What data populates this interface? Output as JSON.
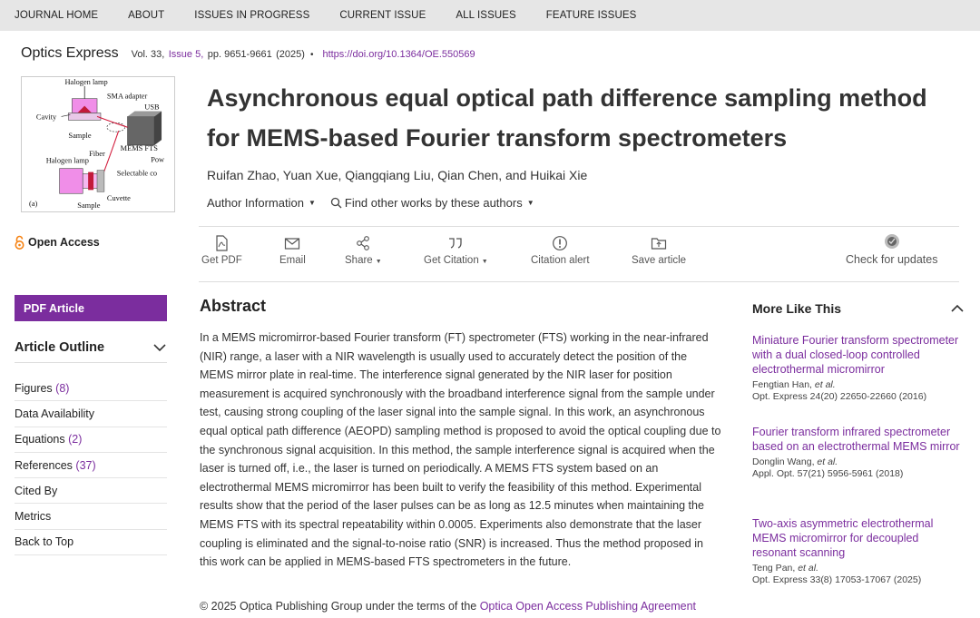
{
  "nav": [
    "JOURNAL HOME",
    "ABOUT",
    "ISSUES IN PROGRESS",
    "CURRENT ISSUE",
    "ALL ISSUES",
    "FEATURE ISSUES"
  ],
  "journal": {
    "name": "Optics Express",
    "vol": "Vol. 33,",
    "issue": "Issue 5,",
    "pages": "pp. 9651-9661",
    "year": "(2025)",
    "doi": "https://doi.org/10.1364/OE.550569"
  },
  "figure": {
    "labels": [
      "Halogen lamp",
      "SMA adapter",
      "USB",
      "Cavity",
      "Sample",
      "MEMS FTS",
      "Fiber",
      "Halogen lamp",
      "Pow",
      "Selectable co",
      "Cuvette",
      "Sample",
      "(a)"
    ]
  },
  "open_access": "Open Access",
  "sidebar": {
    "pdf_label": "PDF Article",
    "outline_title": "Article Outline",
    "items": [
      {
        "label": "Figures",
        "count": "(8)"
      },
      {
        "label": "Data Availability",
        "count": ""
      },
      {
        "label": "Equations",
        "count": "(2)"
      },
      {
        "label": "References",
        "count": "(37)"
      },
      {
        "label": "Cited By",
        "count": ""
      },
      {
        "label": "Metrics",
        "count": ""
      },
      {
        "label": "Back to Top",
        "count": ""
      }
    ]
  },
  "article": {
    "title": "Asynchronous equal optical path difference sampling method for MEMS-based Fourier transform spectrometers",
    "authors": "Ruifan Zhao, Yuan Xue, Qiangqiang Liu, Qian Chen, and Huikai Xie",
    "author_info": "Author Information",
    "find_works": "Find other works by these authors"
  },
  "toolbar": {
    "get_pdf": "Get PDF",
    "email": "Email",
    "share": "Share",
    "get_citation": "Get Citation",
    "citation_alert": "Citation alert",
    "save_article": "Save article",
    "check_updates": "Check for updates"
  },
  "abstract": {
    "heading": "Abstract",
    "body": "In a MEMS micromirror-based Fourier transform (FT) spectrometer (FTS) working in the near-infrared (NIR) range, a laser with a NIR wavelength is usually used to accurately detect the position of the MEMS mirror plate in real-time. The interference signal generated by the NIR laser for position measurement is acquired synchronously with the broadband interference signal from the sample under test, causing strong coupling of the laser signal into the sample signal. In this work, an asynchronous equal optical path difference (AEOPD) sampling method is proposed to avoid the optical coupling due to the synchronous signal acquisition. In this method, the sample interference signal is acquired when the laser is turned off, i.e., the laser is turned on periodically. A MEMS FTS system based on an electrothermal MEMS micromirror has been built to verify the feasibility of this method. Experimental results show that the period of the laser pulses can be as long as 12.5 minutes when maintaining the MEMS FTS with its spectral repeatability within 0.0005. Experiments also demonstrate that the laser coupling is eliminated and the signal-to-noise ratio (SNR) is increased. Thus the method proposed in this work can be applied in MEMS-based FTS spectrometers in the future.",
    "copyright_prefix": "© 2025 Optica Publishing Group under the terms of the",
    "copyright_link": "Optica Open Access Publishing Agreement"
  },
  "more_like_this": {
    "heading": "More Like This",
    "items": [
      {
        "title": "Miniature Fourier transform spectrometer with a dual closed-loop controlled electrothermal micromirror",
        "author": "Fengtian Han,",
        "etal": "et al.",
        "journal": "Opt. Express",
        "vol": "24",
        "rest": "(20) 22650-22660 (2016)"
      },
      {
        "title": "Fourier transform infrared spectrometer based on an electrothermal MEMS mirror",
        "author": "Donglin Wang,",
        "etal": "et al.",
        "journal": "Appl. Opt.",
        "vol": "57",
        "rest": "(21) 5956-5961 (2018)"
      },
      {
        "title": "Two-axis asymmetric electrothermal MEMS micromirror for decoupled resonant scanning",
        "author": "Teng Pan,",
        "etal": "et al.",
        "journal": "Opt. Express",
        "vol": "33",
        "rest": "(8) 17053-17067 (2025)"
      }
    ]
  },
  "colors": {
    "accent": "#7b2d9e",
    "open_access": "#f68212",
    "nav_bg": "#e6e6e6"
  }
}
